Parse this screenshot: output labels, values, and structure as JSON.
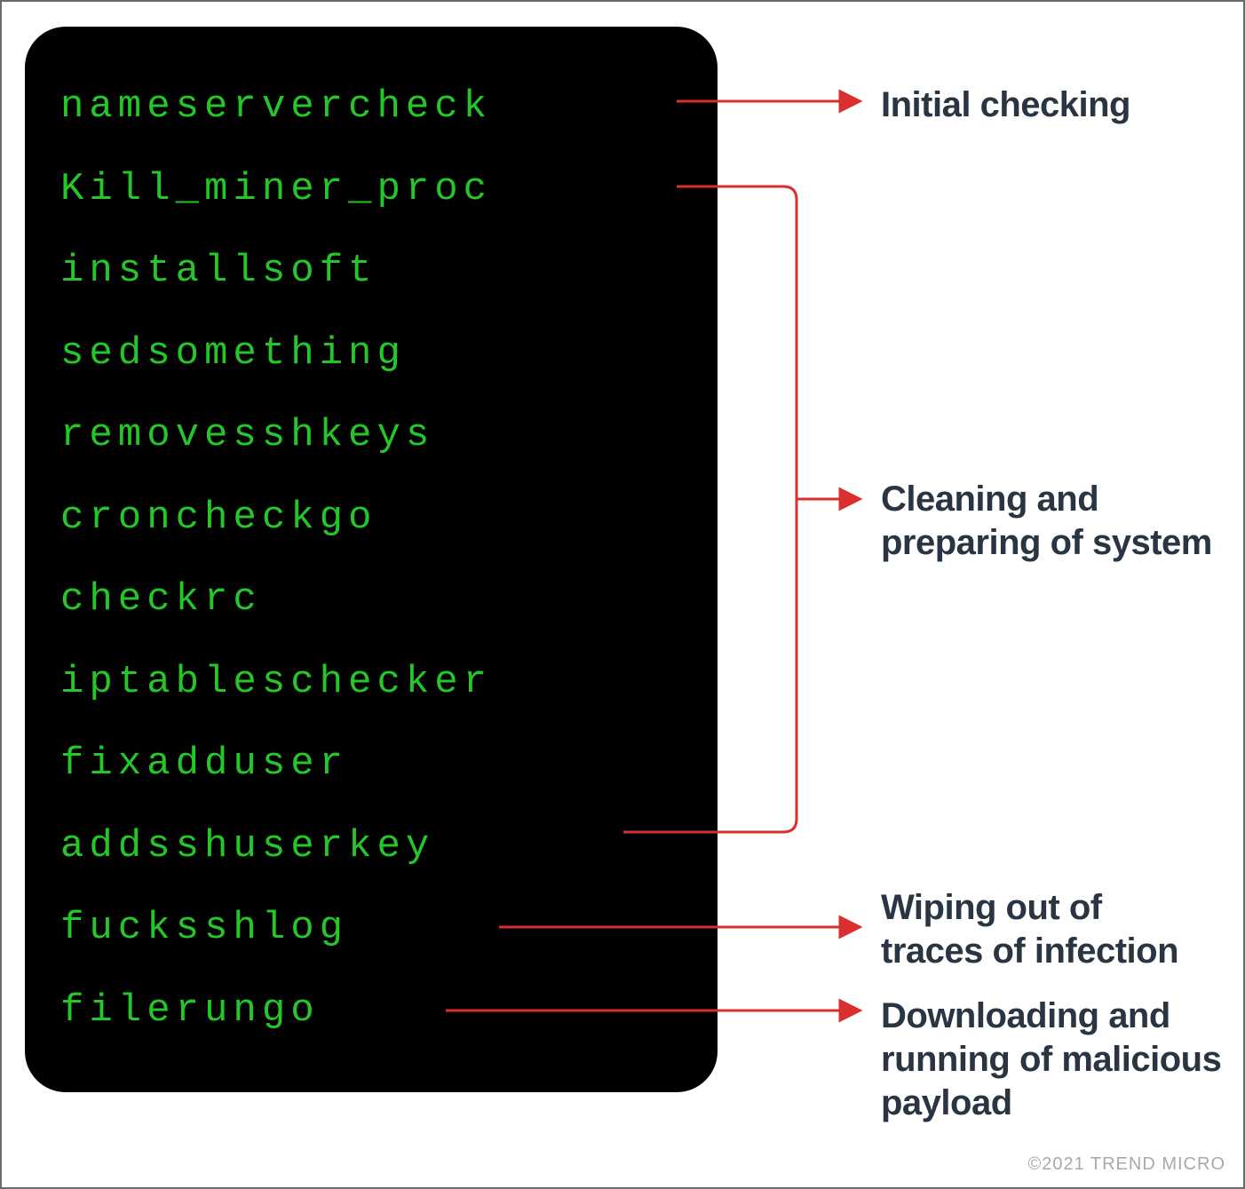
{
  "terminal": {
    "lines": [
      "nameservercheck",
      "Kill_miner_proc",
      "installsoft",
      "sedsomething",
      "removesshkeys",
      "croncheckgo",
      "checkrc",
      "iptableschecker",
      "fixadduser",
      "addsshuserkey",
      "fucksshlog",
      "filerungo"
    ]
  },
  "labels": {
    "initial": "Initial checking",
    "cleaning_l1": "Cleaning and",
    "cleaning_l2": "preparing of system",
    "wiping_l1": "Wiping out of",
    "wiping_l2": "traces of infection",
    "download_l1": "Downloading and",
    "download_l2": "running of malicious",
    "download_l3": "payload"
  },
  "footer": {
    "copyright": "©2021 TREND MICRO"
  },
  "colors": {
    "terminal_bg": "#000000",
    "terminal_text": "#24c629",
    "arrow": "#d92f2f",
    "label_text": "#2a3543"
  }
}
